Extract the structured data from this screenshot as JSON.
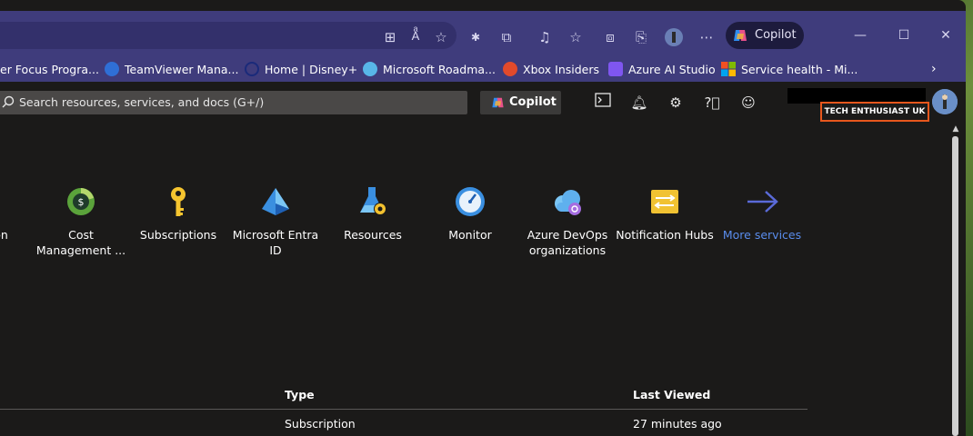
{
  "browser": {
    "copilot_label": "Copilot",
    "bookmarks": [
      {
        "label": "er Focus Progra...",
        "icon": "folder-icon",
        "color": "#f2b43c"
      },
      {
        "label": "TeamViewer Mana...",
        "icon": "teamviewer-icon",
        "color": "#2f6fd6"
      },
      {
        "label": "Home | Disney+",
        "icon": "disney-icon",
        "color": "#1a2a7a"
      },
      {
        "label": "Microsoft Roadma...",
        "icon": "roadmap-icon",
        "color": "#58b6e8"
      },
      {
        "label": "Xbox Insiders",
        "icon": "xbox-insiders-icon",
        "color": "#e24a2b"
      },
      {
        "label": "Azure AI Studio",
        "icon": "azure-ai-studio-icon",
        "color": "#7f56f0"
      },
      {
        "label": "Service health - Mi...",
        "icon": "microsoft-logo-icon",
        "color": "#f25022"
      }
    ]
  },
  "portal": {
    "search_placeholder": "Search resources, services, and docs (G+/)",
    "copilot_label": "Copilot",
    "tenant": "TECH ENTHUSIAST UK"
  },
  "services": [
    {
      "label": "on",
      "link": false
    },
    {
      "label": "Cost Management ...",
      "link": false
    },
    {
      "label": "Subscriptions",
      "link": false
    },
    {
      "label": "Microsoft Entra ID",
      "link": false
    },
    {
      "label": "Resources",
      "link": false
    },
    {
      "label": "Monitor",
      "link": false
    },
    {
      "label": "Azure DevOps organizations",
      "link": false
    },
    {
      "label": "Notification Hubs",
      "link": false
    },
    {
      "label": "More services",
      "link": true
    }
  ],
  "table": {
    "headers": {
      "type": "Type",
      "last_viewed": "Last Viewed"
    },
    "rows": [
      {
        "type": "Subscription",
        "last_viewed": "27 minutes ago"
      }
    ]
  }
}
